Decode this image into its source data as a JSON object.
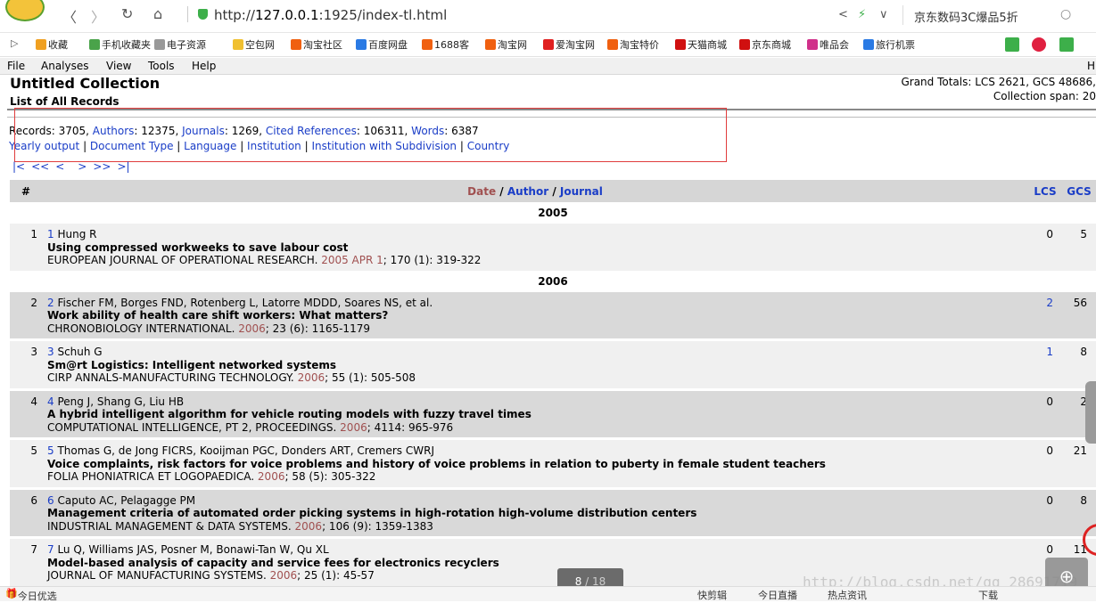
{
  "browser": {
    "back": "〈",
    "forward": "〉",
    "reload": "↻",
    "home": "⌂",
    "url_prefix": "http://",
    "url_host": "127.0.0.1",
    "url_rest": ":1925/index-tl.html",
    "share": "<",
    "flash": "⚡",
    "dropdown": "∨",
    "search_hint": "京东数码3C爆品5折",
    "search_icon": "○"
  },
  "bookmarks": [
    {
      "label": "收藏",
      "color": "#f0a020"
    },
    {
      "label": "手机收藏夹",
      "color": "#4aa34a"
    },
    {
      "label": "电子资源",
      "color": "#999999"
    },
    {
      "label": "空包网",
      "color": "#f0c030"
    },
    {
      "label": "淘宝社区",
      "color": "#f06010"
    },
    {
      "label": "百度网盘",
      "color": "#2a7ae4"
    },
    {
      "label": "1688客",
      "color": "#f06010"
    },
    {
      "label": "淘宝网",
      "color": "#f06010"
    },
    {
      "label": "爱淘宝网",
      "color": "#e02020"
    },
    {
      "label": "淘宝特价",
      "color": "#f06010"
    },
    {
      "label": "天猫商城",
      "color": "#d01010"
    },
    {
      "label": "京东商城",
      "color": "#d01010"
    },
    {
      "label": "唯品会",
      "color": "#d0308a"
    },
    {
      "label": "旅行机票",
      "color": "#2a7ae4"
    }
  ],
  "menu": [
    "File",
    "Analyses",
    "View",
    "Tools",
    "Help"
  ],
  "menu_right": "H",
  "header": {
    "title": "Untitled Collection",
    "subtitle": "List of All Records",
    "grand_totals": "Grand Totals: LCS 2621, GCS 48686,",
    "collection_span": "Collection span: 20"
  },
  "stats": {
    "records_label": "Records",
    "records": "3705",
    "authors_label": "Authors",
    "authors": "12375",
    "journals_label": "Journals",
    "journals": "1269",
    "cited_label": "Cited References",
    "cited": "106311",
    "words_label": "Words",
    "words": "6387",
    "links": [
      "Yearly output",
      "Document Type",
      "Language",
      "Institution",
      "Institution with Subdivision",
      "Country"
    ]
  },
  "pager": [
    "|<",
    "<<",
    "<",
    ">",
    ">>",
    ">|"
  ],
  "table": {
    "col_num": "#",
    "col_date": "Date",
    "col_author": "Author",
    "col_journal": "Journal",
    "col_sep": "/",
    "col_lcs": "LCS",
    "col_gcs": "GCS"
  },
  "groups": [
    {
      "year": "2005",
      "records": [
        {
          "n": "1",
          "idx": "1",
          "authors": "Hung R",
          "title": "Using compressed workweeks to save labour cost",
          "source": "EUROPEAN JOURNAL OF OPERATIONAL RESEARCH.",
          "date": "2005 APR 1",
          "rest": "; 170 (1): 319-322",
          "lcs": "0",
          "lcs_link": false,
          "gcs": "5"
        }
      ]
    },
    {
      "year": "2006",
      "records": [
        {
          "n": "2",
          "idx": "2",
          "authors": "Fischer FM, Borges FND, Rotenberg L, Latorre MDDD, Soares NS, et al.",
          "title": "Work ability of health care shift workers: What matters?",
          "source": "CHRONOBIOLOGY INTERNATIONAL.",
          "date": "2006",
          "rest": "; 23 (6): 1165-1179",
          "lcs": "2",
          "lcs_link": true,
          "gcs": "56"
        },
        {
          "n": "3",
          "idx": "3",
          "authors": "Schuh G",
          "title": "Sm@rt Logistics: Intelligent networked systems",
          "source": "CIRP ANNALS-MANUFACTURING TECHNOLOGY.",
          "date": "2006",
          "rest": "; 55 (1): 505-508",
          "lcs": "1",
          "lcs_link": true,
          "gcs": "8"
        },
        {
          "n": "4",
          "idx": "4",
          "authors": "Peng J, Shang G, Liu HB",
          "title": "A hybrid intelligent algorithm for vehicle routing models with fuzzy travel times",
          "source": "COMPUTATIONAL INTELLIGENCE, PT 2, PROCEEDINGS.",
          "date": "2006",
          "rest": "; 4114: 965-976",
          "lcs": "0",
          "lcs_link": false,
          "gcs": "2"
        },
        {
          "n": "5",
          "idx": "5",
          "authors": "Thomas G, de Jong FICRS, Kooijman PGC, Donders ART, Cremers CWRJ",
          "title": "Voice complaints, risk factors for voice problems and history of voice problems in relation to puberty in female student teachers",
          "source": "FOLIA PHONIATRICA ET LOGOPAEDICA.",
          "date": "2006",
          "rest": "; 58 (5): 305-322",
          "lcs": "0",
          "lcs_link": false,
          "gcs": "21"
        },
        {
          "n": "6",
          "idx": "6",
          "authors": "Caputo AC, Pelagagge PM",
          "title": "Management criteria of automated order picking systems in high-rotation high-volume distribution centers",
          "source": "INDUSTRIAL MANAGEMENT & DATA SYSTEMS.",
          "date": "2006",
          "rest": "; 106 (9): 1359-1383",
          "lcs": "0",
          "lcs_link": false,
          "gcs": "8"
        },
        {
          "n": "7",
          "idx": "7",
          "authors": "Lu Q, Williams JAS, Posner M, Bonawi-Tan W, Qu XL",
          "title": "Model-based analysis of capacity and service fees for electronics recyclers",
          "source": "JOURNAL OF MANUFACTURING SYSTEMS.",
          "date": "2006",
          "rest": "; 25 (1): 45-57",
          "lcs": "0",
          "lcs_link": false,
          "gcs": "11"
        }
      ]
    }
  ],
  "overlay": {
    "page_current": "8",
    "page_total": "/ 18",
    "watermark": "http://blog.csdn.net/qq_28691719",
    "zoom_icon": "⊕"
  },
  "statusbar": {
    "left": "今日优选",
    "items": [
      "快剪辑",
      "今日直播",
      "热点资讯",
      "下载"
    ]
  }
}
